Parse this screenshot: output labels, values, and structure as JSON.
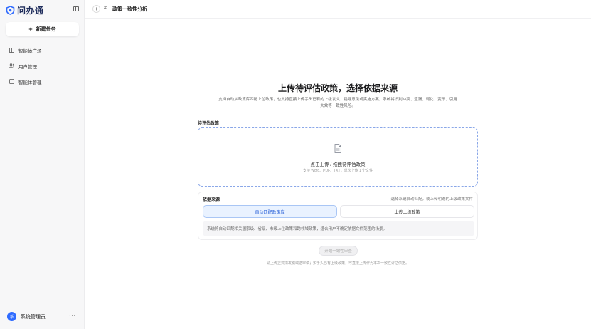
{
  "app": {
    "name": "问办通",
    "logo_icon": "shield-logo-icon"
  },
  "sidebar": {
    "new_task_label": "新建任务",
    "items": [
      {
        "label": "智能体广场",
        "icon": "grid-icon"
      },
      {
        "label": "用户管理",
        "icon": "users-icon"
      },
      {
        "label": "智能体管理",
        "icon": "bot-icon"
      }
    ],
    "user": {
      "avatar_text": "系",
      "name": "系统管理员",
      "more": "···"
    }
  },
  "header": {
    "tab_hash": "#",
    "tab_title": "政策一致性分析"
  },
  "main": {
    "headline": "上传待评估政策，选择依据来源",
    "description": "支持自动从政策库匹配上位政策，也支持直接上传手头已有的上级发文、指导意见或实施方案；系统将识别冲突、遗漏、弱化、变形、引用失效等一致性风险。",
    "upload_section_label": "待评估政策",
    "dropzone": {
      "title": "点击上传 / 拖拽待评估政策",
      "hint": "支持 Word、PDF、TXT，单次上传 1 个文件"
    },
    "basis": {
      "title": "依据来源",
      "note": "选择系统自动匹配，或上传明确的上级政策文件",
      "option_auto": "自动匹配政策库",
      "option_upload": "上传上级政策",
      "info": "系统将自动匹配相关国家级、省级、市级上位政策和跨领域政策，适合用户不确定依据文件范围的场景。"
    },
    "start_button": "开始一致性审查",
    "footer_tip": "请上传正式拟发稿或送审稿；如手头已有上级政策，可直接上传作为本次一致性评估依据。"
  },
  "colors": {
    "accent": "#2f6bff",
    "dropzone_border": "#8aa7e8",
    "selected_bg": "#e9f2ff"
  }
}
